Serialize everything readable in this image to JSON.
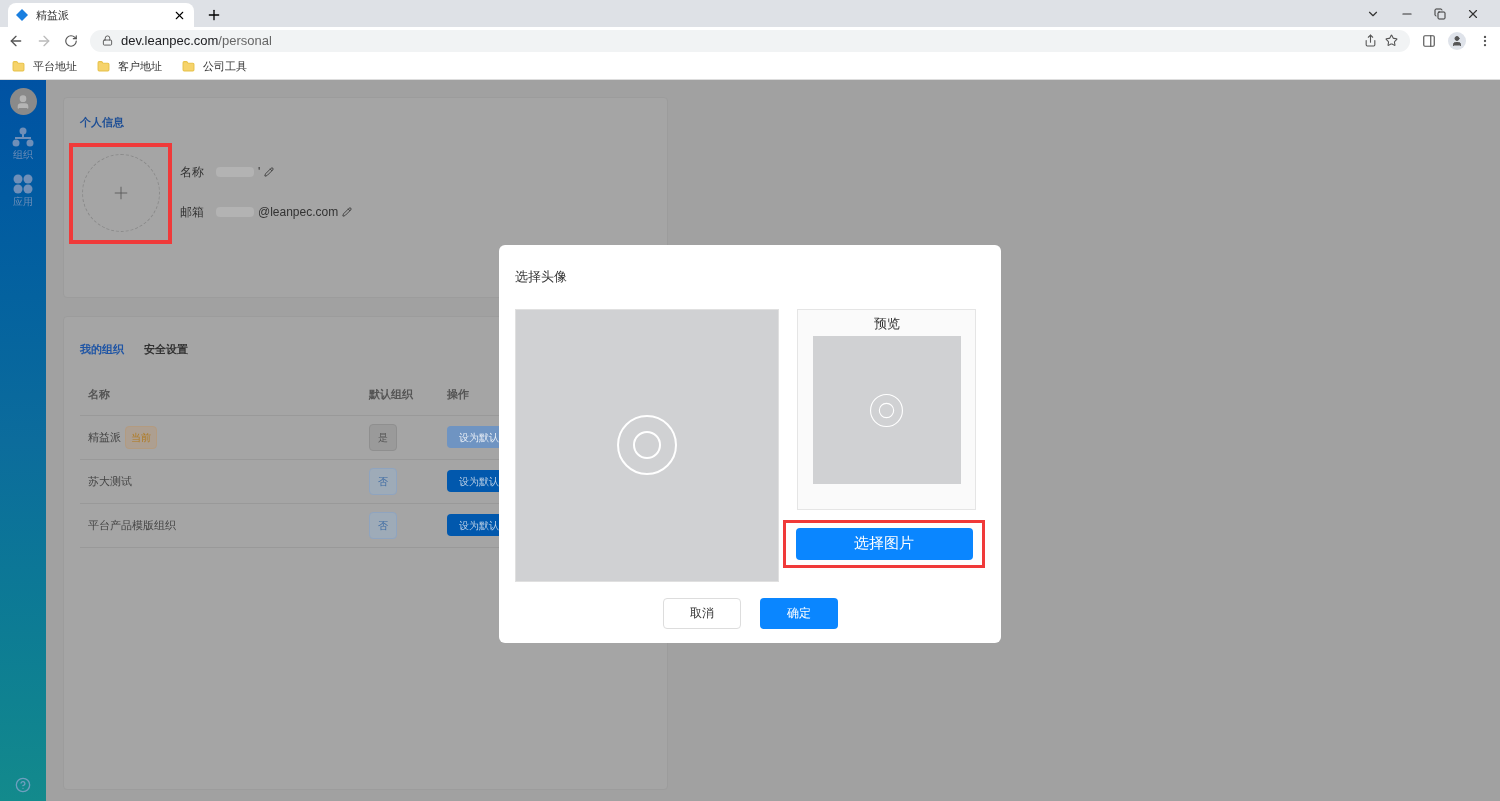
{
  "browser": {
    "tab_title": "精益派",
    "url_host": "dev.leanpec.com",
    "url_path": "/personal",
    "bookmarks": [
      "平台地址",
      "客户地址",
      "公司工具"
    ]
  },
  "sidebar": {
    "items": [
      {
        "kind": "org",
        "label": "组织"
      },
      {
        "kind": "apps",
        "label": "应用"
      }
    ]
  },
  "profile": {
    "title": "个人信息",
    "fields": [
      {
        "label": "名称",
        "value_suffix": "'"
      },
      {
        "label": "邮箱",
        "value_suffix": "@leanpec.com"
      }
    ]
  },
  "orgs": {
    "tabs": [
      {
        "label": "我的组织",
        "selected": true
      },
      {
        "label": "安全设置",
        "selected": false
      }
    ],
    "columns": [
      "名称",
      "默认组织",
      "操作"
    ],
    "rows": [
      {
        "name": "精益派",
        "tag": "当前",
        "default": "是",
        "is_default": true,
        "action": "设为默认",
        "disabled": true
      },
      {
        "name": "苏大测试",
        "default": "否",
        "is_default": false,
        "action": "设为默认",
        "disabled": false
      },
      {
        "name": "平台产品模版组织",
        "default": "否",
        "is_default": false,
        "action": "设为默认",
        "disabled": false
      }
    ]
  },
  "dialog": {
    "title": "选择头像",
    "preview_label": "预览",
    "pick_button": "选择图片",
    "buttons": [
      {
        "kind": "cancel",
        "label": "取消"
      },
      {
        "kind": "primary",
        "label": "确定"
      }
    ]
  }
}
